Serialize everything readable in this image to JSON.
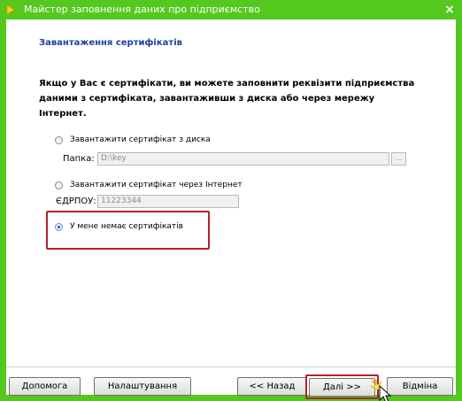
{
  "window": {
    "title": "Майстер заповнення даних про підприємство",
    "close_glyph": "×"
  },
  "page": {
    "section_title": "Завантаження сертифікатів",
    "intro": "Якщо у Вас є сертифікати, ви можете заповнити реквізити підприємства даними з сертифіката, завантаживши з диска або через мережу Інтернет."
  },
  "options": {
    "disk": {
      "label": "Завантажити сертифікат з диска",
      "checked": false,
      "folder_label": "Папка:",
      "folder_value": "D:\\key",
      "browse_label": "..."
    },
    "internet": {
      "label": "Завантажити сертифікат через Інтернет",
      "checked": false,
      "edrpou_label": "ЄДРПОУ:",
      "edrpou_value": "11223344"
    },
    "none": {
      "label": "У мене немає сертифікатів",
      "checked": true
    }
  },
  "buttons": {
    "help": "Допомога",
    "settings": "Налаштування",
    "back": "<< Назад",
    "next": "Далі >>",
    "cancel": "Відміна"
  },
  "colors": {
    "title_bar": "#55c81f",
    "section_title": "#1f3f9f",
    "highlight": "#b4212c"
  }
}
